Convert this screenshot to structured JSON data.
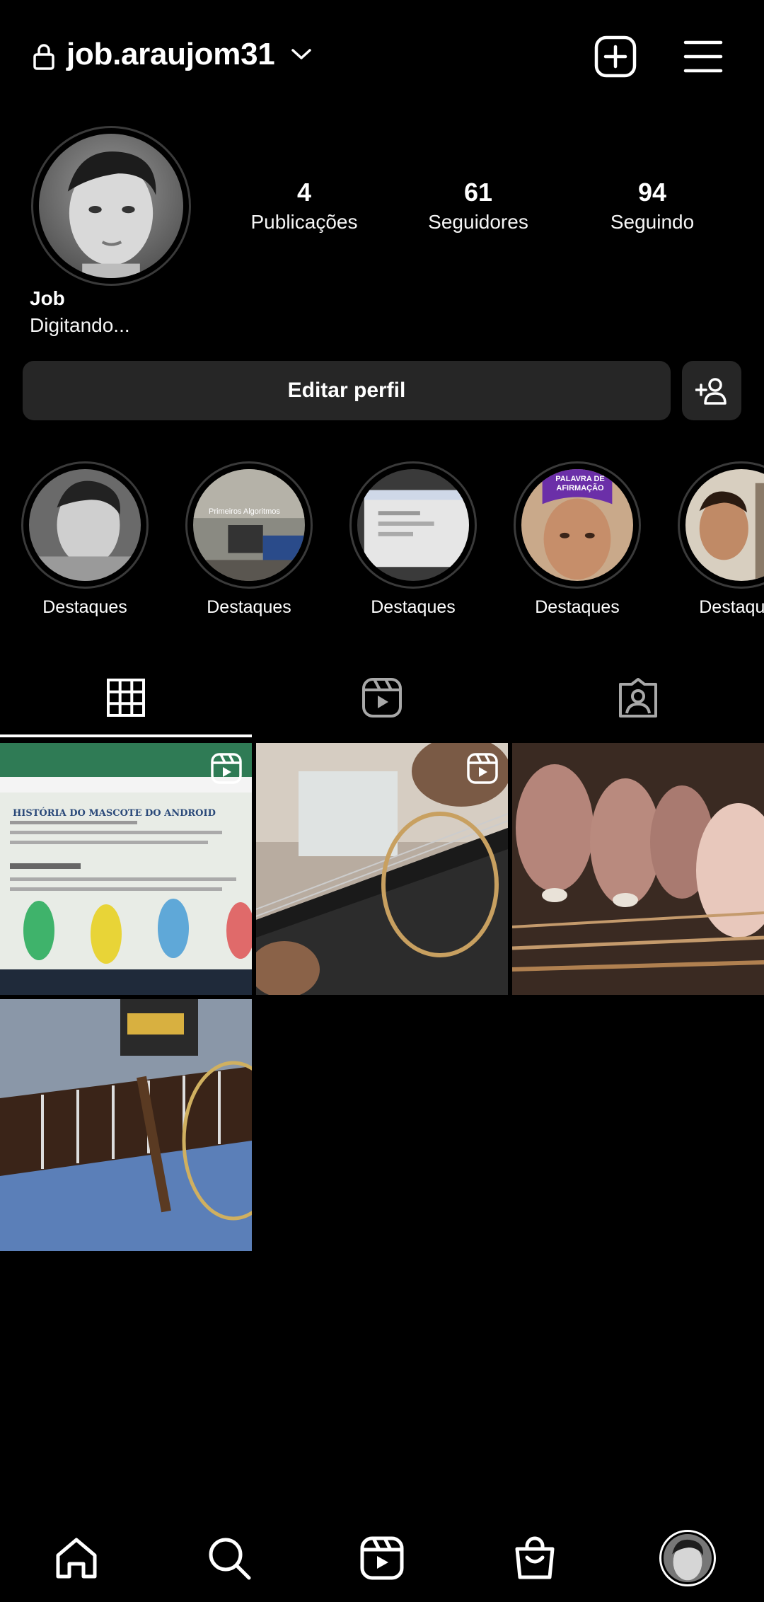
{
  "header": {
    "username": "job.araujom31",
    "icons": {
      "lock": "lock-icon",
      "dropdown": "chevron-down-icon",
      "create": "plus-square-icon",
      "menu": "hamburger-menu-icon"
    }
  },
  "profile": {
    "name": "Job",
    "bio": "Digitando...",
    "stats": [
      {
        "value": "4",
        "label": "Publicações"
      },
      {
        "value": "61",
        "label": "Seguidores"
      },
      {
        "value": "94",
        "label": "Seguindo"
      }
    ]
  },
  "actions": {
    "edit_profile": "Editar perfil",
    "discover_people_icon": "add-person-icon"
  },
  "highlights": [
    {
      "label": "Destaques",
      "overlay_text": ""
    },
    {
      "label": "Destaques",
      "overlay_text": "Primeiros Algoritmos"
    },
    {
      "label": "Destaques",
      "overlay_text": ""
    },
    {
      "label": "Destaques",
      "overlay_text": "PALAVRA DE AFIRMAÇÃO"
    },
    {
      "label": "Destaques",
      "overlay_text": ""
    }
  ],
  "tabs": [
    {
      "icon": "grid-icon",
      "active": true
    },
    {
      "icon": "reels-icon",
      "active": false
    },
    {
      "icon": "tagged-icon",
      "active": false
    }
  ],
  "posts": [
    {
      "type": "reel",
      "thumb_text": "HISTÓRIA DO MASCOTE DO ANDROID"
    },
    {
      "type": "reel",
      "thumb_text": ""
    },
    {
      "type": "photo",
      "thumb_text": ""
    },
    {
      "type": "photo",
      "thumb_text": ""
    }
  ],
  "bottom_nav": [
    {
      "icon": "home-icon"
    },
    {
      "icon": "search-icon"
    },
    {
      "icon": "reels-icon"
    },
    {
      "icon": "shop-icon"
    },
    {
      "icon": "profile-avatar"
    }
  ]
}
